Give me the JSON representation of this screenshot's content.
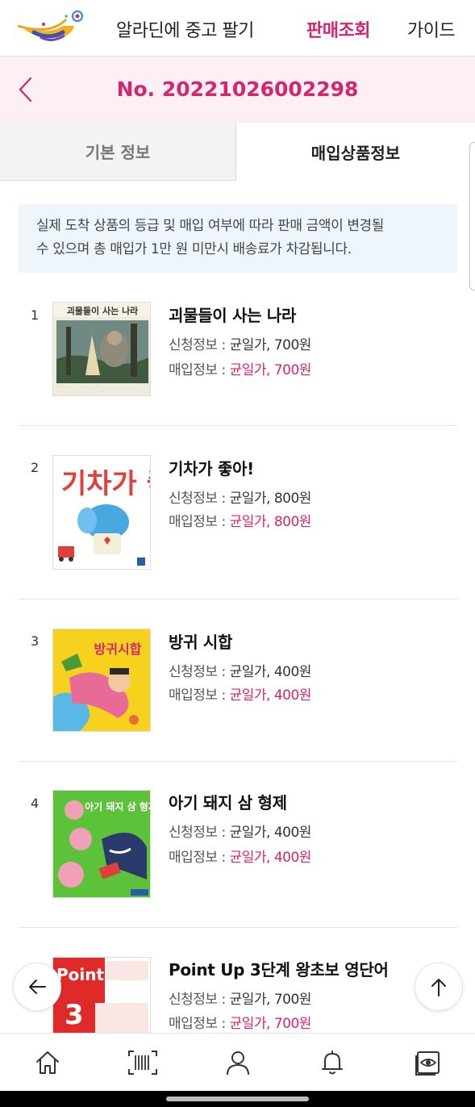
{
  "header": {
    "nav": {
      "sell": "알라딘에 중고 팔기",
      "status": "판매조회",
      "guide": "가이드"
    },
    "colors": {
      "accent": "#d6246e",
      "order_bar_bg": "#fdf0f5"
    }
  },
  "order": {
    "number": "No. 20221026002298"
  },
  "tabs": {
    "basic": "기본 정보",
    "purchase": "매입상품정보",
    "active": "purchase"
  },
  "notice": {
    "line1": "실제 도착 상품의 등급 및 매입 여부에 따라 판매 금액이 변경될",
    "line2": "수 있으며 총 매입가 1만 원 미만시 배송료가 차감됩니다."
  },
  "items": [
    {
      "no": "1",
      "title": "괴물들이 사는 나라",
      "request_label": "신청정보 : ",
      "request_value": "균일가, 700원",
      "purchase_label": "매입정보 : ",
      "purchase_value": "균일가, 700원",
      "cover_text": "괴물들이 사는 나라"
    },
    {
      "no": "2",
      "title": "기차가 좋아!",
      "request_label": "신청정보 : ",
      "request_value": "균일가, 800원",
      "purchase_label": "매입정보 : ",
      "purchase_value": "균일가, 800원",
      "cover_text": "기차가 좋아!"
    },
    {
      "no": "3",
      "title": "방귀 시합",
      "request_label": "신청정보 : ",
      "request_value": "균일가, 400원",
      "purchase_label": "매입정보 : ",
      "purchase_value": "균일가, 400원",
      "cover_text": "방귀시합"
    },
    {
      "no": "4",
      "title": "아기 돼지 삼 형제",
      "request_label": "신청정보 : ",
      "request_value": "균일가, 400원",
      "purchase_label": "매입정보 : ",
      "purchase_value": "균일가, 400원",
      "cover_text": "아기 돼지 삼 형제"
    },
    {
      "no": "5",
      "title": "Point Up 3단계 왕초보 영단어",
      "request_label": "신청정보 : ",
      "request_value": "균일가, 700원",
      "purchase_label": "매입정보 : ",
      "purchase_value": "균일가, 700원",
      "cover_text": "Point up"
    }
  ],
  "icons": {
    "back_button": "arrow-left-icon",
    "top_button": "arrow-up-icon",
    "bottom_nav": [
      "home-icon",
      "barcode-scan-icon",
      "user-icon",
      "bell-icon",
      "eye-book-icon"
    ]
  }
}
